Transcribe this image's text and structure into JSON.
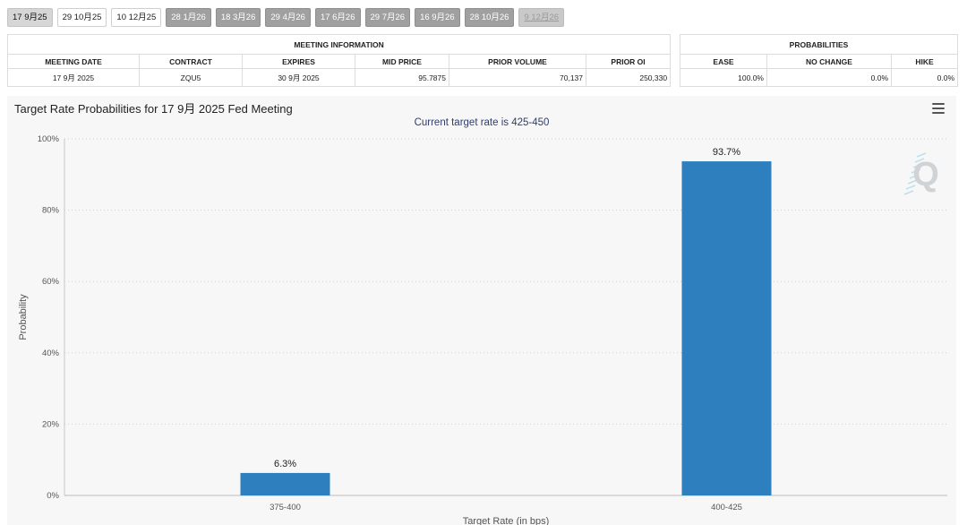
{
  "tabs": [
    {
      "label": "17 9月25",
      "state": "selected"
    },
    {
      "label": "29 10月25",
      "state": "plain"
    },
    {
      "label": "10 12月25",
      "state": "plain"
    },
    {
      "label": "28 1月26",
      "state": "dark"
    },
    {
      "label": "18 3月26",
      "state": "dark"
    },
    {
      "label": "29 4月26",
      "state": "dark"
    },
    {
      "label": "17 6月26",
      "state": "dark"
    },
    {
      "label": "29 7月26",
      "state": "dark"
    },
    {
      "label": "16 9月26",
      "state": "dark"
    },
    {
      "label": "28 10月26",
      "state": "dark"
    },
    {
      "label": "9 12月26",
      "state": "faded"
    }
  ],
  "meeting_info": {
    "header": "MEETING INFORMATION",
    "columns": [
      "MEETING DATE",
      "CONTRACT",
      "EXPIRES",
      "MID PRICE",
      "PRIOR VOLUME",
      "PRIOR OI"
    ],
    "row": {
      "meeting_date": "17 9月 2025",
      "contract": "ZQU5",
      "expires": "30 9月 2025",
      "mid_price": "95.7875",
      "prior_volume": "70,137",
      "prior_oi": "250,330"
    }
  },
  "probabilities": {
    "header": "PROBABILITIES",
    "columns": [
      "EASE",
      "NO CHANGE",
      "HIKE"
    ],
    "row": {
      "ease": "100.0%",
      "no_change": "0.0%",
      "hike": "0.0%"
    }
  },
  "chart_data": {
    "type": "bar",
    "title": "Target Rate Probabilities for 17 9月 2025 Fed Meeting",
    "subtitle": "Current target rate is 425-450",
    "xlabel": "Target Rate (in bps)",
    "ylabel": "Probability",
    "categories": [
      "375-400",
      "400-425"
    ],
    "values": [
      6.3,
      93.7
    ],
    "data_labels": [
      "6.3%",
      "93.7%"
    ],
    "ylim": [
      0,
      100
    ],
    "yticks": [
      "0%",
      "20%",
      "40%",
      "60%",
      "80%",
      "100%"
    ],
    "grid": "horizontal dotted",
    "bar_color": "#2e7fbd",
    "watermark": "Q"
  }
}
